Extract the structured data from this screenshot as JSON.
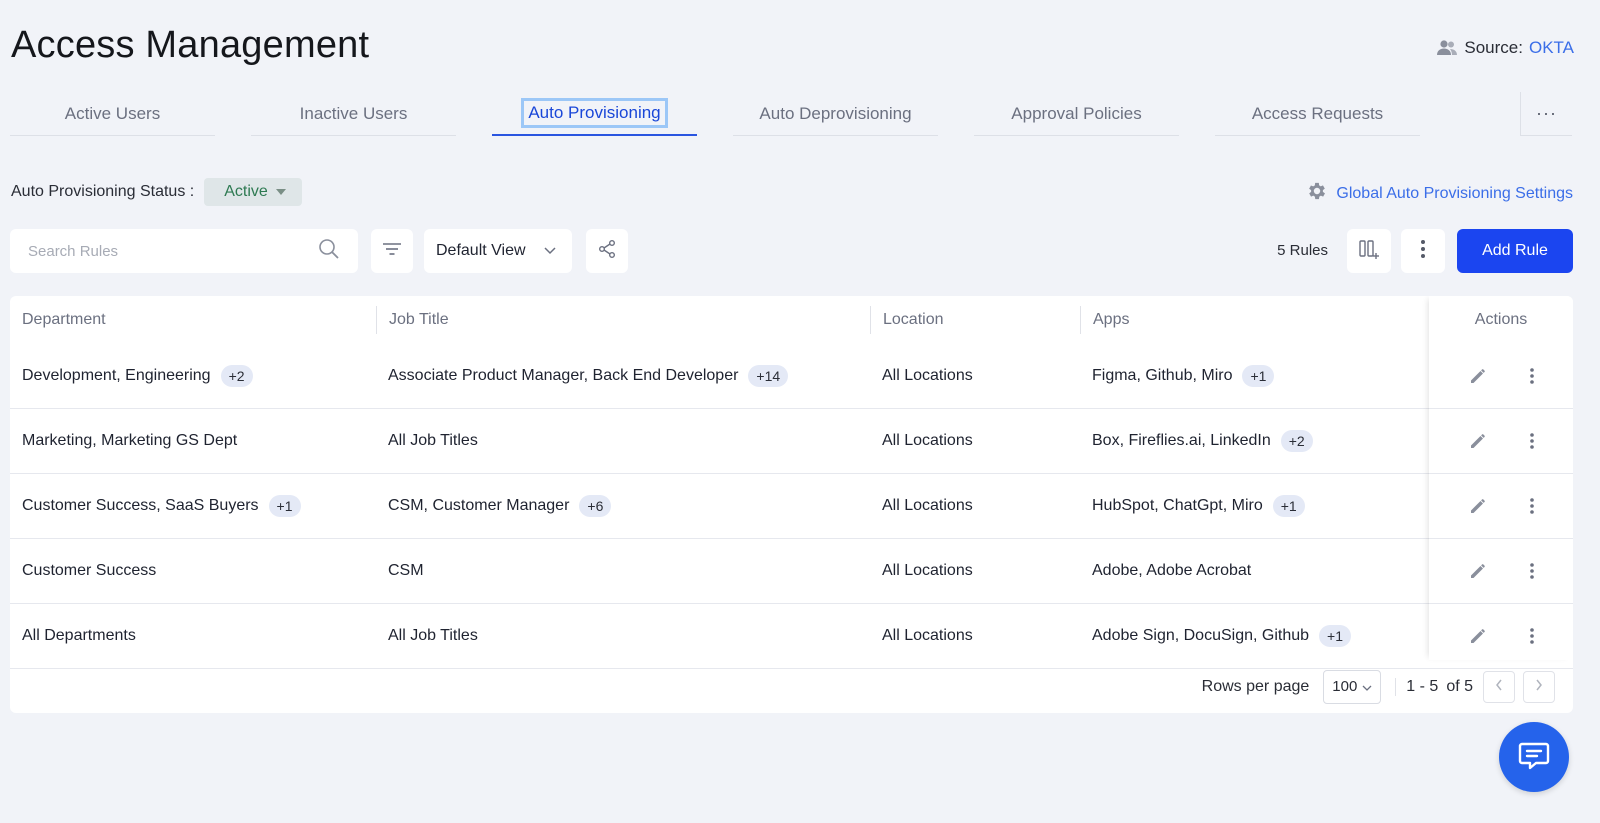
{
  "page": {
    "title": "Access Management"
  },
  "source": {
    "label": "Source:",
    "value": "OKTA"
  },
  "tabs": [
    {
      "label": "Active Users"
    },
    {
      "label": "Inactive Users"
    },
    {
      "label": "Auto Provisioning",
      "active": true
    },
    {
      "label": "Auto Deprovisioning"
    },
    {
      "label": "Approval Policies"
    },
    {
      "label": "Access Requests"
    }
  ],
  "tabs_more": "···",
  "status": {
    "label": "Auto Provisioning Status :",
    "value": "Active"
  },
  "global_settings": {
    "label": "Global Auto Provisioning Settings"
  },
  "toolbar": {
    "search_placeholder": "Search Rules",
    "view": "Default View",
    "rules_count": "5 Rules",
    "add_rule": "Add Rule"
  },
  "table": {
    "headers": {
      "department": "Department",
      "job_title": "Job Title",
      "location": "Location",
      "apps": "Apps",
      "actions": "Actions"
    },
    "rows": [
      {
        "department": "Development, Engineering",
        "department_more": "+2",
        "job_title": "Associate Product Manager, Back End Developer",
        "job_title_more": "+14",
        "location": "All Locations",
        "apps": "Figma, Github, Miro",
        "apps_more": "+1"
      },
      {
        "department": "Marketing, Marketing GS Dept",
        "department_more": "",
        "job_title": "All Job Titles",
        "job_title_more": "",
        "location": "All Locations",
        "apps": "Box, Fireflies.ai, LinkedIn",
        "apps_more": "+2"
      },
      {
        "department": "Customer Success, SaaS Buyers",
        "department_more": "+1",
        "job_title": "CSM, Customer Manager",
        "job_title_more": "+6",
        "location": "All Locations",
        "apps": "HubSpot, ChatGpt, Miro",
        "apps_more": "+1"
      },
      {
        "department": "Customer Success",
        "department_more": "",
        "job_title": "CSM",
        "job_title_more": "",
        "location": "All Locations",
        "apps": "Adobe, Adobe Acrobat",
        "apps_more": ""
      },
      {
        "department": "All Departments",
        "department_more": "",
        "job_title": "All Job Titles",
        "job_title_more": "",
        "location": "All Locations",
        "apps": "Adobe Sign, DocuSign, Github",
        "apps_more": "+1"
      }
    ]
  },
  "pagination": {
    "rows_per_page_label": "Rows per page",
    "rows_per_page": "100",
    "range": "1 - 5",
    "of": "of 5"
  },
  "colors": {
    "primary": "#1b45f0",
    "link": "#3b6ee8",
    "status_green": "#2e7a52"
  }
}
